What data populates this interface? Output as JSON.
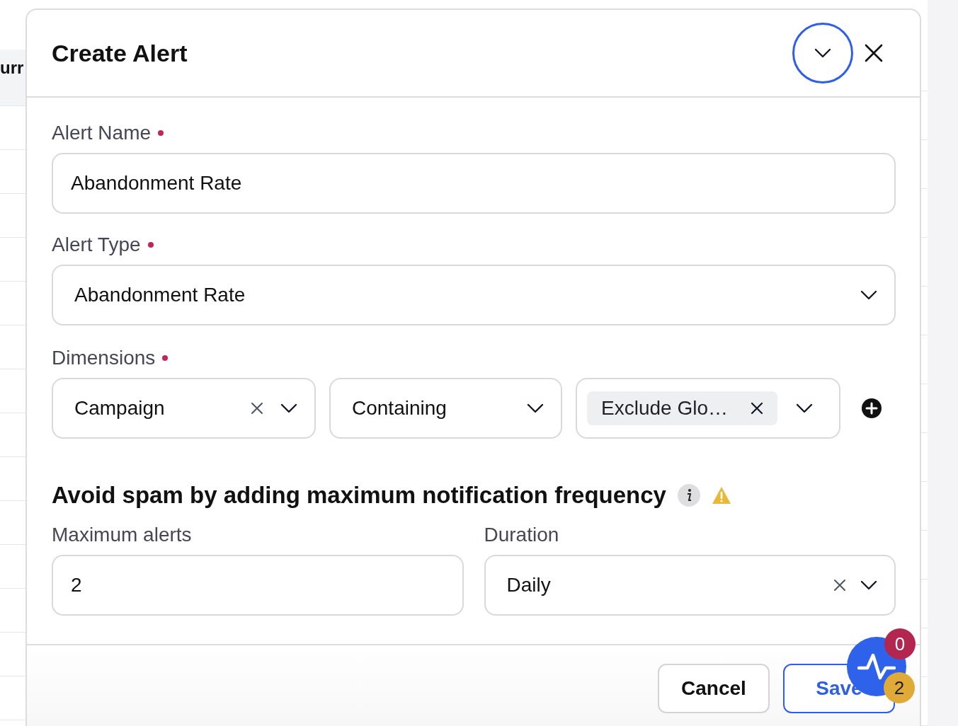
{
  "background_table": {
    "column_1_header": "urr"
  },
  "dialog": {
    "title": "Create Alert"
  },
  "alert_name": {
    "label": "Alert Name",
    "required": true,
    "value": "Abandonment Rate"
  },
  "alert_type": {
    "label": "Alert Type",
    "required": true,
    "value": "Abandonment Rate"
  },
  "dimensions": {
    "label": "Dimensions",
    "required": true,
    "selects": [
      {
        "kind": "select",
        "value": "Campaign",
        "clearable": true
      },
      {
        "kind": "select",
        "value": "Containing",
        "clearable": false
      },
      {
        "kind": "tags",
        "tag": "Exclude Glo…"
      }
    ]
  },
  "frequency": {
    "heading": "Avoid spam by adding maximum notification frequency",
    "max_alerts": {
      "label": "Maximum alerts",
      "value": "2"
    },
    "duration": {
      "label": "Duration",
      "value": "Daily",
      "clearable": true
    }
  },
  "footer": {
    "buttons": [
      {
        "label": "Cancel",
        "kind": "secondary"
      },
      {
        "label": "Save",
        "kind": "primary"
      }
    ]
  },
  "activity_widget": {
    "badges": [
      {
        "count": "0",
        "color": "#b3264f"
      },
      {
        "count": "2",
        "color": "#e0aa38"
      }
    ]
  }
}
